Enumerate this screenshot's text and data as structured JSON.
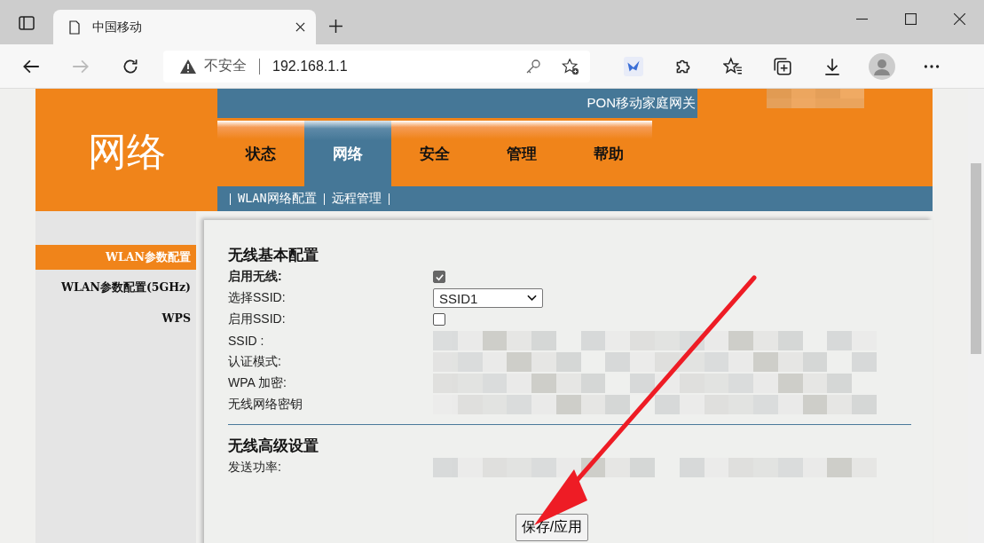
{
  "browser": {
    "tab_title": "中国移动",
    "security": "不安全",
    "address": "192.168.1.1"
  },
  "header": {
    "brand": "网络",
    "banner": "PON移动家庭网关",
    "nav": [
      {
        "label": "状态",
        "selected": false
      },
      {
        "label": "网络",
        "selected": true
      },
      {
        "label": "安全",
        "selected": false
      },
      {
        "label": "管理",
        "selected": false
      },
      {
        "label": "帮助",
        "selected": false
      }
    ],
    "subnav": [
      "WLAN网络配置",
      "远程管理"
    ]
  },
  "sidebar": {
    "items": [
      {
        "label": "WLAN参数配置",
        "selected": true
      },
      {
        "label": "WLAN参数配置(5GHz)",
        "selected": false
      },
      {
        "label": "WPS",
        "selected": false
      }
    ]
  },
  "sections": [
    {
      "title": "无线基本配置",
      "rows": [
        {
          "label": "启用无线:",
          "bold": true,
          "kind": "checkbox",
          "checked": true
        },
        {
          "label": "选择SSID:",
          "bold": false,
          "kind": "select",
          "value": "SSID1"
        },
        {
          "label": "启用SSID:",
          "bold": false,
          "kind": "checkbox",
          "checked": false
        },
        {
          "label": "SSID :",
          "bold": false,
          "kind": "hidden"
        },
        {
          "label": "认证模式:",
          "bold": false,
          "kind": "hidden"
        },
        {
          "label": "WPA 加密:",
          "bold": false,
          "kind": "hidden"
        },
        {
          "label": "无线网络密钥",
          "bold": false,
          "kind": "hidden"
        }
      ]
    },
    {
      "title": "无线高级设置",
      "rows": [
        {
          "label": "发送功率:",
          "bold": false,
          "kind": "hidden"
        }
      ]
    }
  ],
  "save_button": "保存/应用"
}
